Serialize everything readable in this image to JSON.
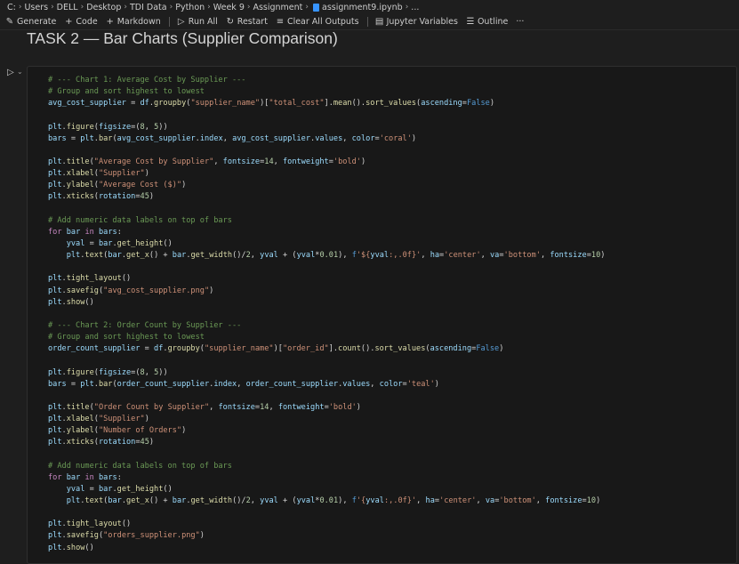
{
  "breadcrumb": {
    "items": [
      "C:",
      "Users",
      "DELL",
      "Desktop",
      "TDI Data",
      "Python",
      "Week 9",
      "Assignment"
    ],
    "file": "assignment9.ipynb",
    "trail": "..."
  },
  "toolbar": {
    "generate": "Generate",
    "code": "Code",
    "markdown": "Markdown",
    "run_all": "Run All",
    "restart": "Restart",
    "clear_all": "Clear All Outputs",
    "jupyter_vars": "Jupyter Variables",
    "outline": "Outline",
    "more": "···"
  },
  "icons": {
    "generate": "sparkle-icon",
    "code": "plus-icon",
    "markdown": "plus-icon",
    "run_all": "run-all-icon",
    "restart": "restart-icon",
    "clear": "clear-outputs-icon",
    "variables": "variables-icon",
    "outline": "outline-icon",
    "run_cell": "run-icon"
  },
  "heading": "TASK 2 — Bar Charts (Supplier Comparison)",
  "code_lines": [
    [
      [
        "c",
        "# --- Chart 1: Average Cost by Supplier ---"
      ]
    ],
    [
      [
        "c",
        "# Group and sort highest to lowest"
      ]
    ],
    [
      [
        "v",
        "avg_cost_supplier"
      ],
      [
        "p",
        " = "
      ],
      [
        "v",
        "df"
      ],
      [
        "p",
        "."
      ],
      [
        "f",
        "groupby"
      ],
      [
        "p",
        "("
      ],
      [
        "s",
        "\"supplier_name\""
      ],
      [
        "p",
        ")["
      ],
      [
        "s",
        "\"total_cost\""
      ],
      [
        "p",
        "]."
      ],
      [
        "f",
        "mean"
      ],
      [
        "p",
        "()."
      ],
      [
        "f",
        "sort_values"
      ],
      [
        "p",
        "("
      ],
      [
        "v",
        "ascending"
      ],
      [
        "p",
        "="
      ],
      [
        "k2",
        "False"
      ],
      [
        "p",
        ")"
      ]
    ],
    [],
    [
      [
        "v",
        "plt"
      ],
      [
        "p",
        "."
      ],
      [
        "f",
        "figure"
      ],
      [
        "p",
        "("
      ],
      [
        "v",
        "figsize"
      ],
      [
        "p",
        "=("
      ],
      [
        "n",
        "8"
      ],
      [
        "p",
        ", "
      ],
      [
        "n",
        "5"
      ],
      [
        "p",
        "))"
      ]
    ],
    [
      [
        "v",
        "bars"
      ],
      [
        "p",
        " = "
      ],
      [
        "v",
        "plt"
      ],
      [
        "p",
        "."
      ],
      [
        "f",
        "bar"
      ],
      [
        "p",
        "("
      ],
      [
        "v",
        "avg_cost_supplier"
      ],
      [
        "p",
        "."
      ],
      [
        "v",
        "index"
      ],
      [
        "p",
        ", "
      ],
      [
        "v",
        "avg_cost_supplier"
      ],
      [
        "p",
        "."
      ],
      [
        "v",
        "values"
      ],
      [
        "p",
        ", "
      ],
      [
        "v",
        "color"
      ],
      [
        "p",
        "="
      ],
      [
        "s",
        "'coral'"
      ],
      [
        "p",
        ")"
      ]
    ],
    [],
    [
      [
        "v",
        "plt"
      ],
      [
        "p",
        "."
      ],
      [
        "f",
        "title"
      ],
      [
        "p",
        "("
      ],
      [
        "s",
        "\"Average Cost by Supplier\""
      ],
      [
        "p",
        ", "
      ],
      [
        "v",
        "fontsize"
      ],
      [
        "p",
        "="
      ],
      [
        "n",
        "14"
      ],
      [
        "p",
        ", "
      ],
      [
        "v",
        "fontweight"
      ],
      [
        "p",
        "="
      ],
      [
        "s",
        "'bold'"
      ],
      [
        "p",
        ")"
      ]
    ],
    [
      [
        "v",
        "plt"
      ],
      [
        "p",
        "."
      ],
      [
        "f",
        "xlabel"
      ],
      [
        "p",
        "("
      ],
      [
        "s",
        "\"Supplier\""
      ],
      [
        "p",
        ")"
      ]
    ],
    [
      [
        "v",
        "plt"
      ],
      [
        "p",
        "."
      ],
      [
        "f",
        "ylabel"
      ],
      [
        "p",
        "("
      ],
      [
        "s",
        "\"Average Cost ($)\""
      ],
      [
        "p",
        ")"
      ]
    ],
    [
      [
        "v",
        "plt"
      ],
      [
        "p",
        "."
      ],
      [
        "f",
        "xticks"
      ],
      [
        "p",
        "("
      ],
      [
        "v",
        "rotation"
      ],
      [
        "p",
        "="
      ],
      [
        "n",
        "45"
      ],
      [
        "p",
        ")"
      ]
    ],
    [],
    [
      [
        "c",
        "# Add numeric data labels on top of bars"
      ]
    ],
    [
      [
        "k",
        "for"
      ],
      [
        "p",
        " "
      ],
      [
        "v",
        "bar"
      ],
      [
        "p",
        " "
      ],
      [
        "k",
        "in"
      ],
      [
        "p",
        " "
      ],
      [
        "v",
        "bars"
      ],
      [
        "p",
        ":"
      ]
    ],
    [
      [
        "p",
        "    "
      ],
      [
        "v",
        "yval"
      ],
      [
        "p",
        " = "
      ],
      [
        "v",
        "bar"
      ],
      [
        "p",
        "."
      ],
      [
        "f",
        "get_height"
      ],
      [
        "p",
        "()"
      ]
    ],
    [
      [
        "p",
        "    "
      ],
      [
        "v",
        "plt"
      ],
      [
        "p",
        "."
      ],
      [
        "f",
        "text"
      ],
      [
        "p",
        "("
      ],
      [
        "v",
        "bar"
      ],
      [
        "p",
        "."
      ],
      [
        "f",
        "get_x"
      ],
      [
        "p",
        "() + "
      ],
      [
        "v",
        "bar"
      ],
      [
        "p",
        "."
      ],
      [
        "f",
        "get_width"
      ],
      [
        "p",
        "()/"
      ],
      [
        "n",
        "2"
      ],
      [
        "p",
        ", "
      ],
      [
        "v",
        "yval"
      ],
      [
        "p",
        " + ("
      ],
      [
        "v",
        "yval"
      ],
      [
        "p",
        "*"
      ],
      [
        "n",
        "0.01"
      ],
      [
        "p",
        "), "
      ],
      [
        "k2",
        "f"
      ],
      [
        "s",
        "'${"
      ],
      [
        "v",
        "yval"
      ],
      [
        "s",
        ":,.0f}'"
      ],
      [
        "p",
        ", "
      ],
      [
        "v",
        "ha"
      ],
      [
        "p",
        "="
      ],
      [
        "s",
        "'center'"
      ],
      [
        "p",
        ", "
      ],
      [
        "v",
        "va"
      ],
      [
        "p",
        "="
      ],
      [
        "s",
        "'bottom'"
      ],
      [
        "p",
        ", "
      ],
      [
        "v",
        "fontsize"
      ],
      [
        "p",
        "="
      ],
      [
        "n",
        "10"
      ],
      [
        "p",
        ")"
      ]
    ],
    [],
    [
      [
        "v",
        "plt"
      ],
      [
        "p",
        "."
      ],
      [
        "f",
        "tight_layout"
      ],
      [
        "p",
        "()"
      ]
    ],
    [
      [
        "v",
        "plt"
      ],
      [
        "p",
        "."
      ],
      [
        "f",
        "savefig"
      ],
      [
        "p",
        "("
      ],
      [
        "s",
        "\"avg_cost_supplier.png\""
      ],
      [
        "p",
        ")"
      ]
    ],
    [
      [
        "v",
        "plt"
      ],
      [
        "p",
        "."
      ],
      [
        "f",
        "show"
      ],
      [
        "p",
        "()"
      ]
    ],
    [],
    [
      [
        "c",
        "# --- Chart 2: Order Count by Supplier ---"
      ]
    ],
    [
      [
        "c",
        "# Group and sort highest to lowest"
      ]
    ],
    [
      [
        "v",
        "order_count_supplier"
      ],
      [
        "p",
        " = "
      ],
      [
        "v",
        "df"
      ],
      [
        "p",
        "."
      ],
      [
        "f",
        "groupby"
      ],
      [
        "p",
        "("
      ],
      [
        "s",
        "\"supplier_name\""
      ],
      [
        "p",
        ")["
      ],
      [
        "s",
        "\"order_id\""
      ],
      [
        "p",
        "]."
      ],
      [
        "f",
        "count"
      ],
      [
        "p",
        "()."
      ],
      [
        "f",
        "sort_values"
      ],
      [
        "p",
        "("
      ],
      [
        "v",
        "ascending"
      ],
      [
        "p",
        "="
      ],
      [
        "k2",
        "False"
      ],
      [
        "p",
        ")"
      ]
    ],
    [],
    [
      [
        "v",
        "plt"
      ],
      [
        "p",
        "."
      ],
      [
        "f",
        "figure"
      ],
      [
        "p",
        "("
      ],
      [
        "v",
        "figsize"
      ],
      [
        "p",
        "=("
      ],
      [
        "n",
        "8"
      ],
      [
        "p",
        ", "
      ],
      [
        "n",
        "5"
      ],
      [
        "p",
        "))"
      ]
    ],
    [
      [
        "v",
        "bars"
      ],
      [
        "p",
        " = "
      ],
      [
        "v",
        "plt"
      ],
      [
        "p",
        "."
      ],
      [
        "f",
        "bar"
      ],
      [
        "p",
        "("
      ],
      [
        "v",
        "order_count_supplier"
      ],
      [
        "p",
        "."
      ],
      [
        "v",
        "index"
      ],
      [
        "p",
        ", "
      ],
      [
        "v",
        "order_count_supplier"
      ],
      [
        "p",
        "."
      ],
      [
        "v",
        "values"
      ],
      [
        "p",
        ", "
      ],
      [
        "v",
        "color"
      ],
      [
        "p",
        "="
      ],
      [
        "s",
        "'teal'"
      ],
      [
        "p",
        ")"
      ]
    ],
    [],
    [
      [
        "v",
        "plt"
      ],
      [
        "p",
        "."
      ],
      [
        "f",
        "title"
      ],
      [
        "p",
        "("
      ],
      [
        "s",
        "\"Order Count by Supplier\""
      ],
      [
        "p",
        ", "
      ],
      [
        "v",
        "fontsize"
      ],
      [
        "p",
        "="
      ],
      [
        "n",
        "14"
      ],
      [
        "p",
        ", "
      ],
      [
        "v",
        "fontweight"
      ],
      [
        "p",
        "="
      ],
      [
        "s",
        "'bold'"
      ],
      [
        "p",
        ")"
      ]
    ],
    [
      [
        "v",
        "plt"
      ],
      [
        "p",
        "."
      ],
      [
        "f",
        "xlabel"
      ],
      [
        "p",
        "("
      ],
      [
        "s",
        "\"Supplier\""
      ],
      [
        "p",
        ")"
      ]
    ],
    [
      [
        "v",
        "plt"
      ],
      [
        "p",
        "."
      ],
      [
        "f",
        "ylabel"
      ],
      [
        "p",
        "("
      ],
      [
        "s",
        "\"Number of Orders\""
      ],
      [
        "p",
        ")"
      ]
    ],
    [
      [
        "v",
        "plt"
      ],
      [
        "p",
        "."
      ],
      [
        "f",
        "xticks"
      ],
      [
        "p",
        "("
      ],
      [
        "v",
        "rotation"
      ],
      [
        "p",
        "="
      ],
      [
        "n",
        "45"
      ],
      [
        "p",
        ")"
      ]
    ],
    [],
    [
      [
        "c",
        "# Add numeric data labels on top of bars"
      ]
    ],
    [
      [
        "k",
        "for"
      ],
      [
        "p",
        " "
      ],
      [
        "v",
        "bar"
      ],
      [
        "p",
        " "
      ],
      [
        "k",
        "in"
      ],
      [
        "p",
        " "
      ],
      [
        "v",
        "bars"
      ],
      [
        "p",
        ":"
      ]
    ],
    [
      [
        "p",
        "    "
      ],
      [
        "v",
        "yval"
      ],
      [
        "p",
        " = "
      ],
      [
        "v",
        "bar"
      ],
      [
        "p",
        "."
      ],
      [
        "f",
        "get_height"
      ],
      [
        "p",
        "()"
      ]
    ],
    [
      [
        "p",
        "    "
      ],
      [
        "v",
        "plt"
      ],
      [
        "p",
        "."
      ],
      [
        "f",
        "text"
      ],
      [
        "p",
        "("
      ],
      [
        "v",
        "bar"
      ],
      [
        "p",
        "."
      ],
      [
        "f",
        "get_x"
      ],
      [
        "p",
        "() + "
      ],
      [
        "v",
        "bar"
      ],
      [
        "p",
        "."
      ],
      [
        "f",
        "get_width"
      ],
      [
        "p",
        "()/"
      ],
      [
        "n",
        "2"
      ],
      [
        "p",
        ", "
      ],
      [
        "v",
        "yval"
      ],
      [
        "p",
        " + ("
      ],
      [
        "v",
        "yval"
      ],
      [
        "p",
        "*"
      ],
      [
        "n",
        "0.01"
      ],
      [
        "p",
        "), "
      ],
      [
        "k2",
        "f"
      ],
      [
        "s",
        "'{"
      ],
      [
        "v",
        "yval"
      ],
      [
        "s",
        ":,.0f}'"
      ],
      [
        "p",
        ", "
      ],
      [
        "v",
        "ha"
      ],
      [
        "p",
        "="
      ],
      [
        "s",
        "'center'"
      ],
      [
        "p",
        ", "
      ],
      [
        "v",
        "va"
      ],
      [
        "p",
        "="
      ],
      [
        "s",
        "'bottom'"
      ],
      [
        "p",
        ", "
      ],
      [
        "v",
        "fontsize"
      ],
      [
        "p",
        "="
      ],
      [
        "n",
        "10"
      ],
      [
        "p",
        ")"
      ]
    ],
    [],
    [
      [
        "v",
        "plt"
      ],
      [
        "p",
        "."
      ],
      [
        "f",
        "tight_layout"
      ],
      [
        "p",
        "()"
      ]
    ],
    [
      [
        "v",
        "plt"
      ],
      [
        "p",
        "."
      ],
      [
        "f",
        "savefig"
      ],
      [
        "p",
        "("
      ],
      [
        "s",
        "\"orders_supplier.png\""
      ],
      [
        "p",
        ")"
      ]
    ],
    [
      [
        "v",
        "plt"
      ],
      [
        "p",
        "."
      ],
      [
        "f",
        "show"
      ],
      [
        "p",
        "()"
      ]
    ]
  ]
}
